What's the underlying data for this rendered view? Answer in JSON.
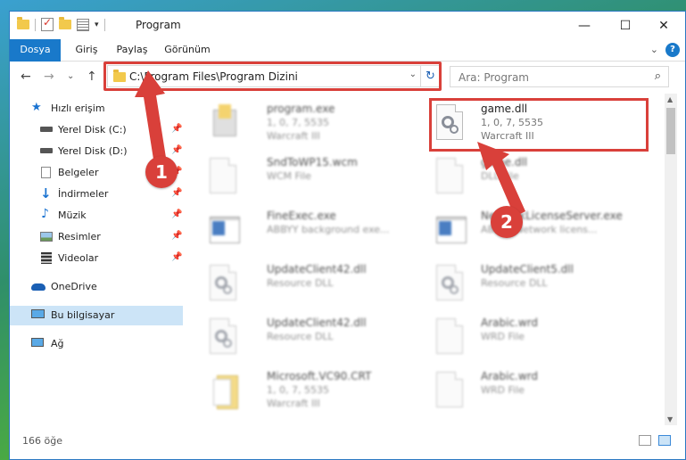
{
  "window": {
    "title": "Program",
    "minimize_glyph": "—",
    "maximize_glyph": "☐",
    "close_glyph": "✕"
  },
  "ribbon": {
    "tabs": [
      "Dosya",
      "Giriş",
      "Paylaş",
      "Görünüm"
    ],
    "help_glyph": "?",
    "expand_glyph": "⌄"
  },
  "nav": {
    "back_glyph": "←",
    "forward_glyph": "→",
    "recent_glyph": "⌄",
    "up_glyph": "↑",
    "address": "C:\\Program Files\\Program Dizini",
    "address_dropdown_glyph": "⌄",
    "refresh_glyph": "↻",
    "search_placeholder": "Ara: Program",
    "search_glyph": "⌕"
  },
  "sidebar": {
    "items": [
      {
        "label": "Hızlı erişim",
        "icon": "star-icon"
      },
      {
        "label": "Yerel Disk (C:)",
        "icon": "drive-icon",
        "pinned": true
      },
      {
        "label": "Yerel Disk (D:)",
        "icon": "drive-icon",
        "pinned": true
      },
      {
        "label": "Belgeler",
        "icon": "documents-icon",
        "pinned": true
      },
      {
        "label": "İndirmeler",
        "icon": "download-icon",
        "pinned": true
      },
      {
        "label": "Müzik",
        "icon": "music-icon",
        "pinned": true
      },
      {
        "label": "Resimler",
        "icon": "pictures-icon",
        "pinned": true
      },
      {
        "label": "Videolar",
        "icon": "videos-icon",
        "pinned": true
      },
      {
        "label": "OneDrive",
        "icon": "cloud-icon"
      },
      {
        "label": "Bu bilgisayar",
        "icon": "computer-icon",
        "selected": true
      },
      {
        "label": "Ağ",
        "icon": "network-icon"
      }
    ],
    "pin_glyph": "📌"
  },
  "files": [
    {
      "name": "program.exe",
      "line1": "1, 0, 7, 5535",
      "line2": "Warcraft III",
      "icon": "installer-icon"
    },
    {
      "name": "game.dll",
      "line1": "1, 0, 7, 5535",
      "line2": "Warcraft III",
      "icon": "dll-gear-icon"
    },
    {
      "name": "SndToWP15.wcm",
      "line1": "WCM File",
      "line2": "",
      "icon": "blank-file-icon"
    },
    {
      "name": "game.dll",
      "line1": "DLL File",
      "line2": "",
      "icon": "blank-file-icon"
    },
    {
      "name": "FineExec.exe",
      "line1": "ABBYY background exe...",
      "line2": "",
      "icon": "app-window-icon"
    },
    {
      "name": "NetworkLicenseServer.exe",
      "line1": "ABBYY Network licens...",
      "line2": "",
      "icon": "app-window-icon"
    },
    {
      "name": "UpdateClient42.dll",
      "line1": "Resource DLL",
      "line2": "",
      "icon": "dll-gear-icon"
    },
    {
      "name": "UpdateClient5.dll",
      "line1": "Resource DLL",
      "line2": "",
      "icon": "dll-gear-icon"
    },
    {
      "name": "UpdateClient42.dll",
      "line1": "Resource DLL",
      "line2": "",
      "icon": "dll-gear-icon"
    },
    {
      "name": "Arabic.wrd",
      "line1": "WRD File",
      "line2": "",
      "icon": "blank-file-icon"
    },
    {
      "name": "Microsoft.VC90.CRT",
      "line1": "1, 0, 7, 5535",
      "line2": "Warcraft III",
      "icon": "folder-doc-icon"
    },
    {
      "name": "Arabic.wrd",
      "line1": "WRD File",
      "line2": "",
      "icon": "blank-file-icon"
    }
  ],
  "status": {
    "count": "166 öğe"
  },
  "annotations": {
    "step1": "1",
    "step2": "2",
    "highlight_color": "#d9403a"
  }
}
